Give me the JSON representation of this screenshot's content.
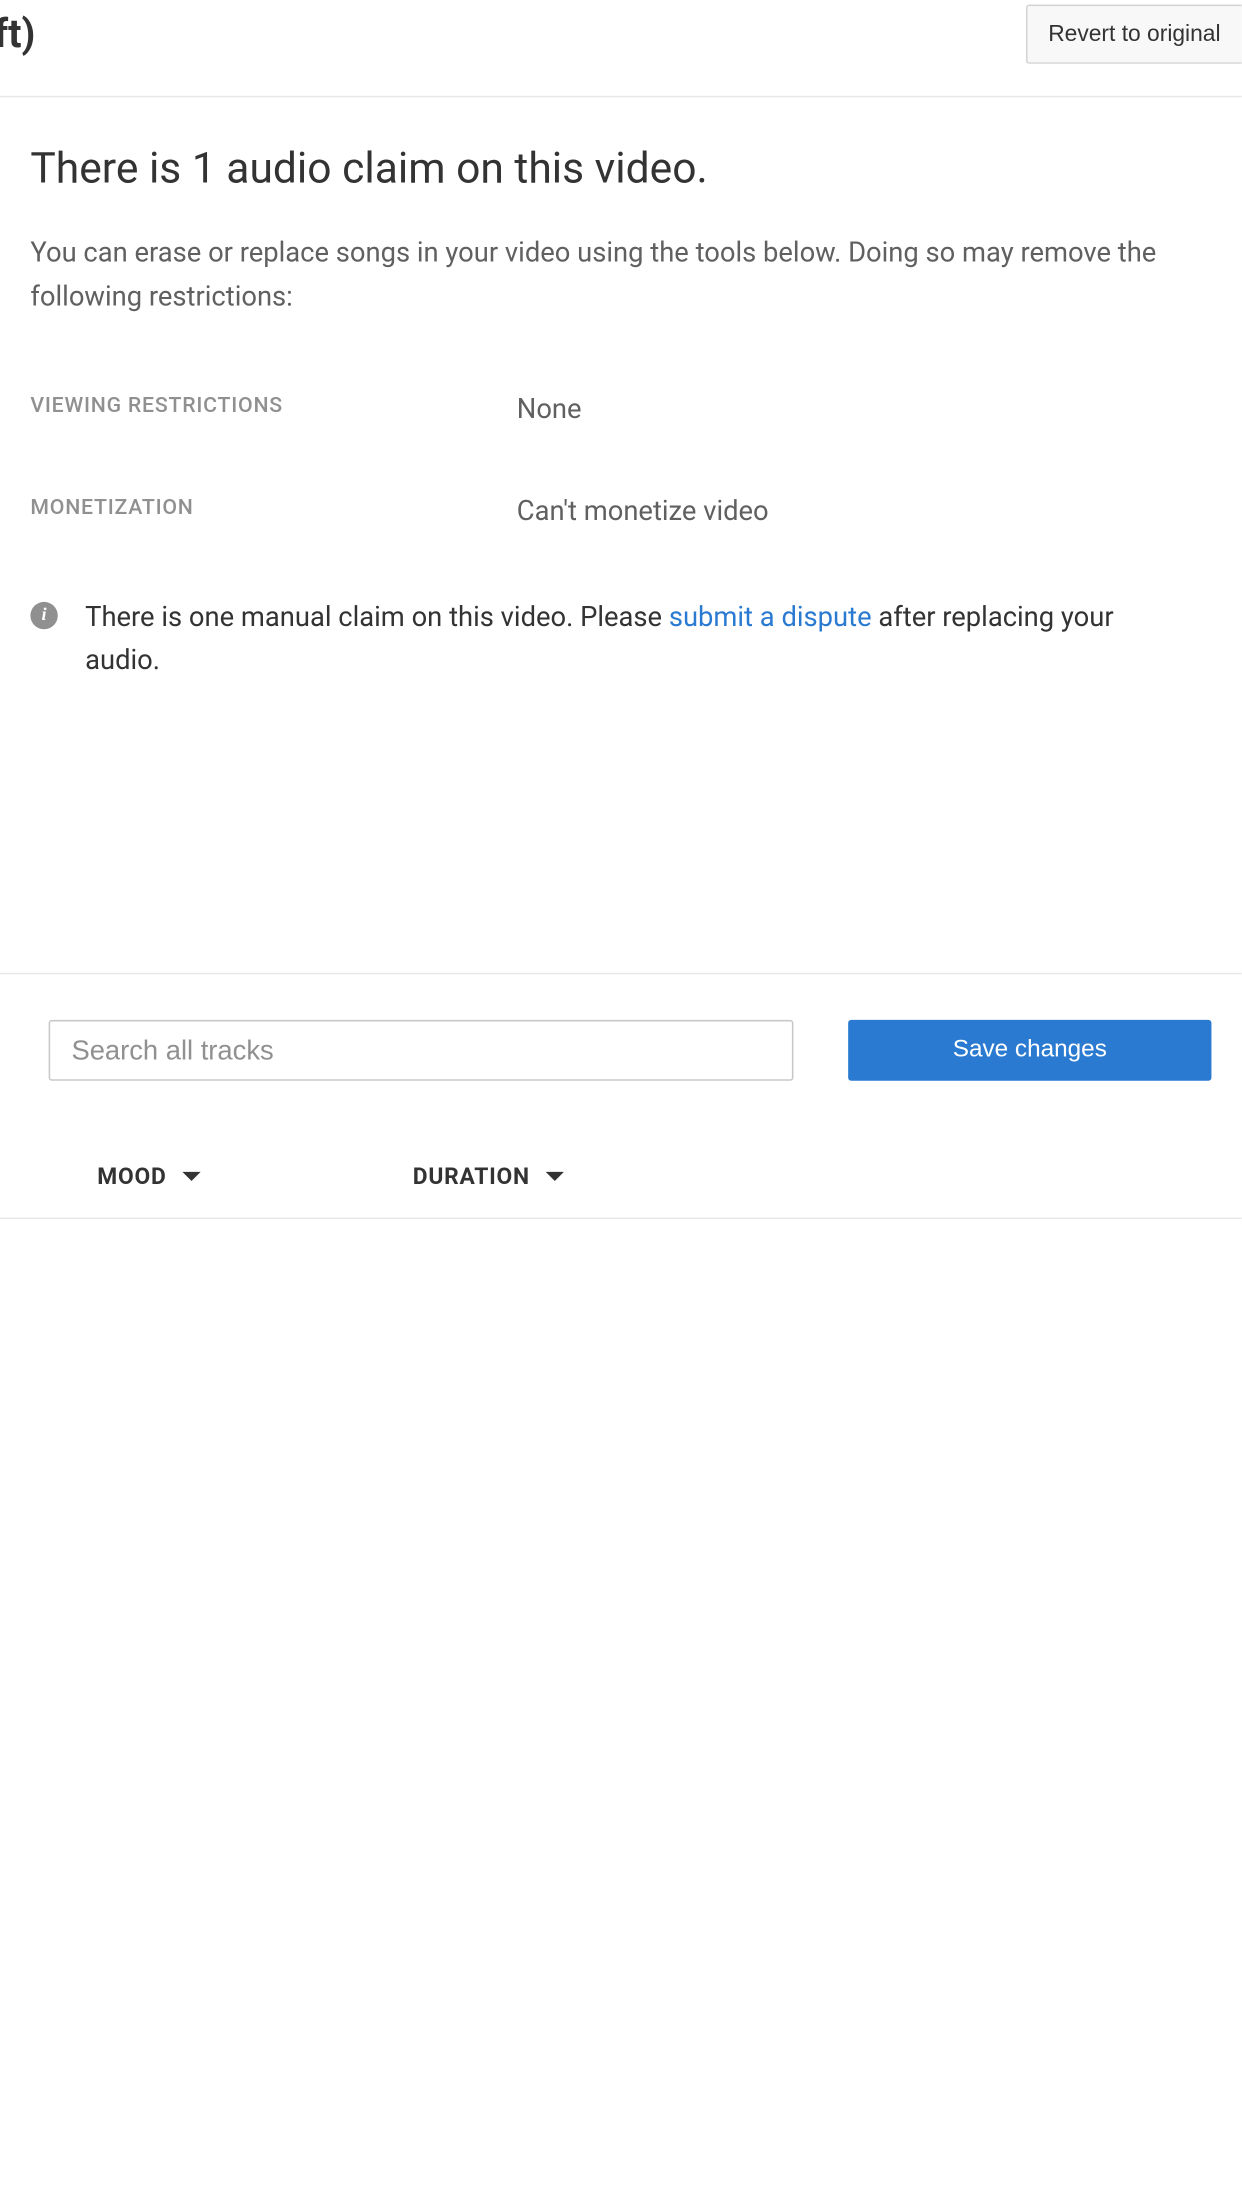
{
  "header": {
    "title_fragment": "eft)",
    "revert_label": "Revert to original"
  },
  "claim": {
    "title": "There is 1 audio claim on this video.",
    "description": "You can erase or replace songs in your video using the tools below. Doing so may remove the following restrictions:",
    "restrictions": [
      {
        "label": "VIEWING RESTRICTIONS",
        "value": "None"
      },
      {
        "label": "MONETIZATION",
        "value": "Can't monetize video"
      }
    ],
    "info_prefix": "There is one manual claim on this video. Please ",
    "info_link": "submit a dispute",
    "info_suffix": " after replacing your audio."
  },
  "tracks": {
    "search_placeholder": "Search all tracks",
    "save_label": "Save changes",
    "filters": [
      {
        "label": "MOOD"
      },
      {
        "label": "DURATION"
      }
    ]
  }
}
